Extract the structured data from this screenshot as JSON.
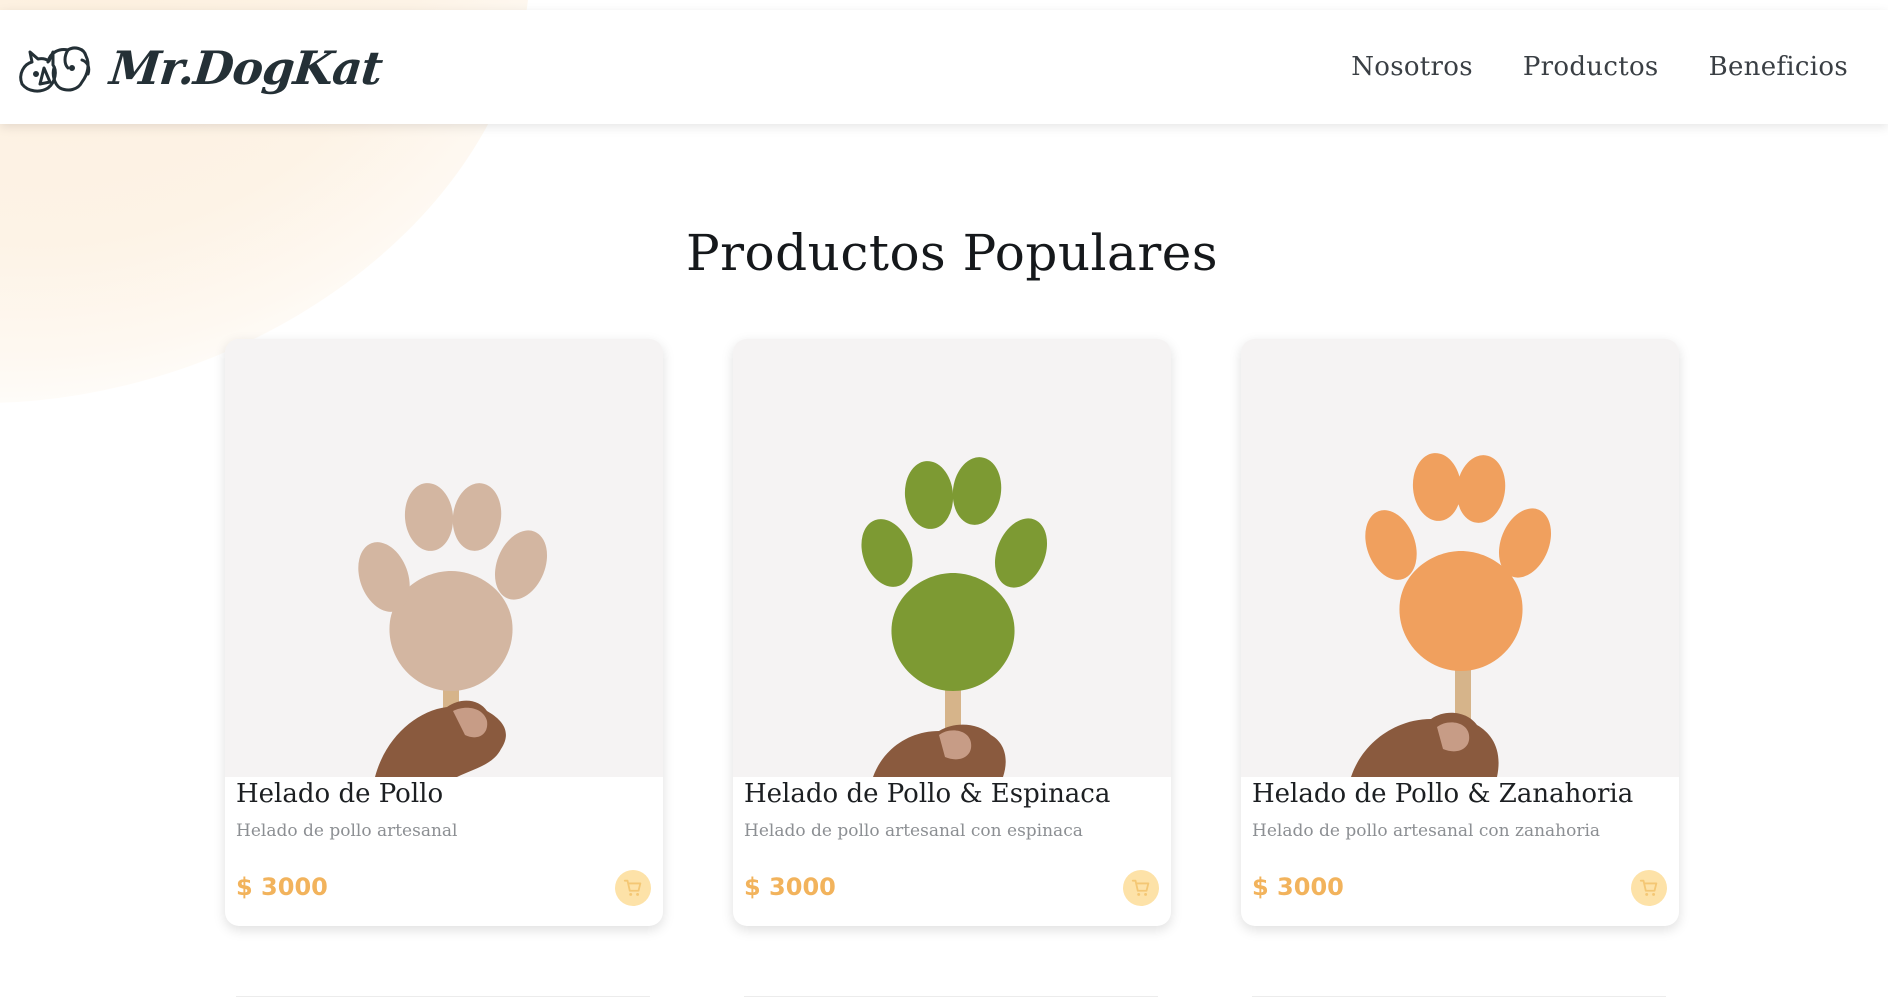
{
  "brand": {
    "name": "Mr.DogKat",
    "logo_icon": "dog-cat-logo-icon"
  },
  "nav": {
    "items": [
      {
        "label": "Nosotros"
      },
      {
        "label": "Productos"
      },
      {
        "label": "Beneficios"
      }
    ]
  },
  "products_section": {
    "title": "Productos Populares",
    "products": [
      {
        "title": "Helado de Pollo",
        "description": "Helado de pollo artesanal",
        "price": "$ 3000",
        "image_icon": "paw-popsicle-image",
        "popsicle_color": "#d3b6a1",
        "cart_icon": "cart-icon"
      },
      {
        "title": "Helado de Pollo & Espinaca",
        "description": "Helado de pollo artesanal con espinaca",
        "price": "$ 3000",
        "image_icon": "paw-popsicle-image",
        "popsicle_color": "#7d9a33",
        "cart_icon": "cart-icon"
      },
      {
        "title": "Helado de Pollo & Zanahoria",
        "description": "Helado de pollo artesanal con zanahoria",
        "price": "$ 3000",
        "image_icon": "paw-popsicle-image",
        "popsicle_color": "#f0a05e",
        "cart_icon": "cart-icon"
      }
    ]
  },
  "colors": {
    "accent_price": "#f2b35c",
    "cart_button_bg": "#fde2a8",
    "background_blob": "#fdf0df",
    "card_image_bg": "#f5f3f3"
  }
}
